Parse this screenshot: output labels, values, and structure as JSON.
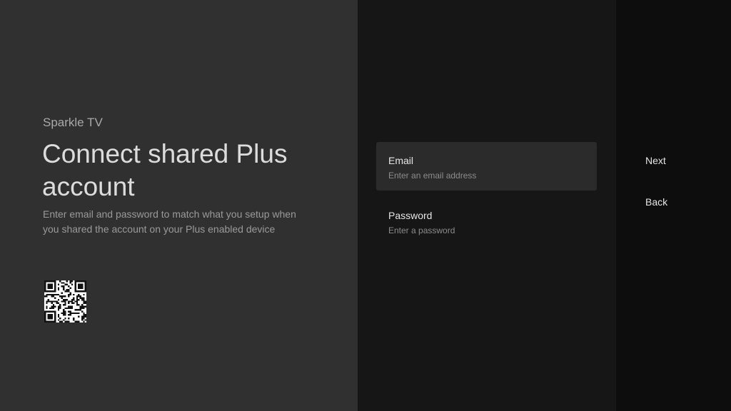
{
  "header": {
    "app_name": "Sparkle TV",
    "title": "Connect shared Plus account",
    "description": "Enter email and password to match what you setup when you shared the account on your Plus enabled device"
  },
  "qr_code": {
    "icon": "qr-code-icon"
  },
  "form": {
    "email": {
      "label": "Email",
      "placeholder": "Enter an email address",
      "focused": true
    },
    "password": {
      "label": "Password",
      "placeholder": "Enter a password",
      "focused": false
    }
  },
  "actions": {
    "next_label": "Next",
    "back_label": "Back"
  },
  "colors": {
    "left_panel": "#303030",
    "middle_panel": "#161616",
    "right_panel": "#0d0d0d",
    "focused_field": "#2b2b2b"
  }
}
